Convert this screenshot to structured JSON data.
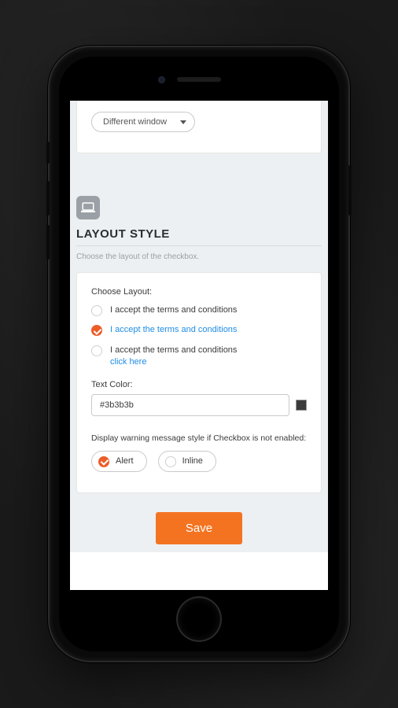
{
  "dropdown": {
    "selected": "Different window"
  },
  "section": {
    "title": "LAYOUT STYLE",
    "description": "Choose the layout of the checkbox."
  },
  "layout": {
    "choose_label": "Choose Layout:",
    "options": [
      {
        "text": "I accept the terms and conditions",
        "linkStyle": false,
        "sublink": null,
        "checked": false
      },
      {
        "text": "I accept the terms and conditions",
        "linkStyle": true,
        "sublink": null,
        "checked": true
      },
      {
        "text": "I accept the terms and conditions",
        "linkStyle": false,
        "sublink": "click here",
        "checked": false
      }
    ]
  },
  "text_color": {
    "label": "Text Color:",
    "value": "#3b3b3b"
  },
  "warning": {
    "label": "Display warning message style if Checkbox is not enabled:",
    "options": [
      {
        "label": "Alert",
        "checked": true
      },
      {
        "label": "Inline",
        "checked": false
      }
    ]
  },
  "save_label": "Save"
}
